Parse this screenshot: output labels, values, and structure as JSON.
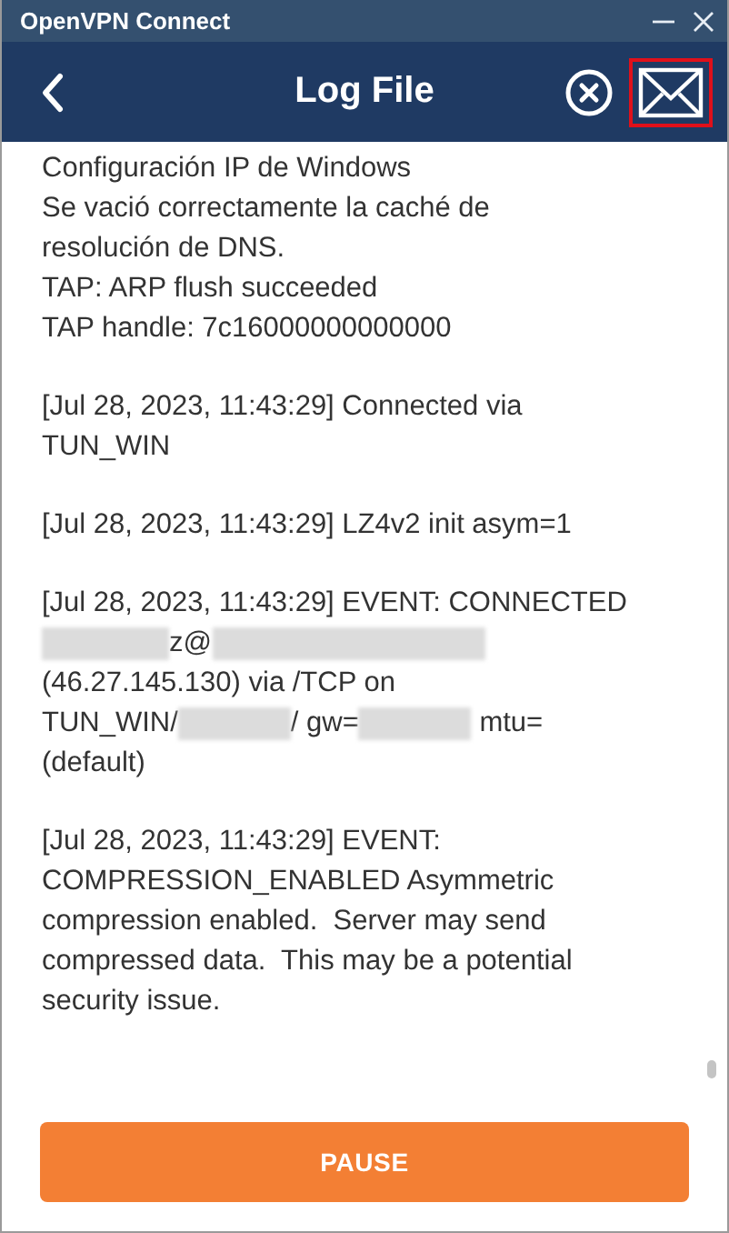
{
  "window": {
    "title": "OpenVPN Connect"
  },
  "header": {
    "title": "Log File",
    "mail_highlighted": true
  },
  "log": [
    {
      "lines": [
        [
          {
            "kind": "text",
            "text": "Configuración IP de Windows"
          }
        ],
        [
          {
            "kind": "text",
            "text": "Se vació correctamente la caché de"
          }
        ],
        [
          {
            "kind": "text",
            "text": "resolución de DNS."
          }
        ],
        [
          {
            "kind": "text",
            "text": "TAP: ARP flush succeeded"
          }
        ],
        [
          {
            "kind": "text",
            "text": "TAP handle: 7c16000000000000"
          }
        ]
      ]
    },
    {
      "lines": [
        [
          {
            "kind": "text",
            "text": "[Jul 28, 2023, 11:43:29] Connected via"
          }
        ],
        [
          {
            "kind": "text",
            "text": "TUN_WIN"
          }
        ]
      ]
    },
    {
      "lines": [
        [
          {
            "kind": "text",
            "text": "[Jul 28, 2023, 11:43:29] LZ4v2 init asym=1"
          }
        ]
      ]
    },
    {
      "lines": [
        [
          {
            "kind": "text",
            "text": "[Jul 28, 2023, 11:43:29] EVENT: CONNECTED"
          }
        ],
        [
          {
            "kind": "redacted_medium"
          },
          {
            "kind": "text",
            "text": "z@"
          },
          {
            "kind": "redacted_long"
          }
        ],
        [
          {
            "kind": "text",
            "text": "(46.27.145.130) via /TCP on"
          }
        ],
        [
          {
            "kind": "text",
            "text": "TUN_WIN/"
          },
          {
            "kind": "redacted_short"
          },
          {
            "kind": "text",
            "text": "/ gw="
          },
          {
            "kind": "redacted_short"
          },
          {
            "kind": "text",
            "text": " mtu="
          }
        ],
        [
          {
            "kind": "text",
            "text": "(default)"
          }
        ]
      ]
    },
    {
      "lines": [
        [
          {
            "kind": "text",
            "text": "[Jul 28, 2023, 11:43:29] EVENT:"
          }
        ],
        [
          {
            "kind": "text",
            "text": "COMPRESSION_ENABLED Asymmetric"
          }
        ],
        [
          {
            "kind": "text",
            "text": "compression enabled.  Server may send"
          }
        ],
        [
          {
            "kind": "text",
            "text": "compressed data.  This may be a potential"
          }
        ],
        [
          {
            "kind": "text",
            "text": "security issue."
          }
        ]
      ]
    }
  ],
  "button": {
    "label": "PAUSE"
  }
}
